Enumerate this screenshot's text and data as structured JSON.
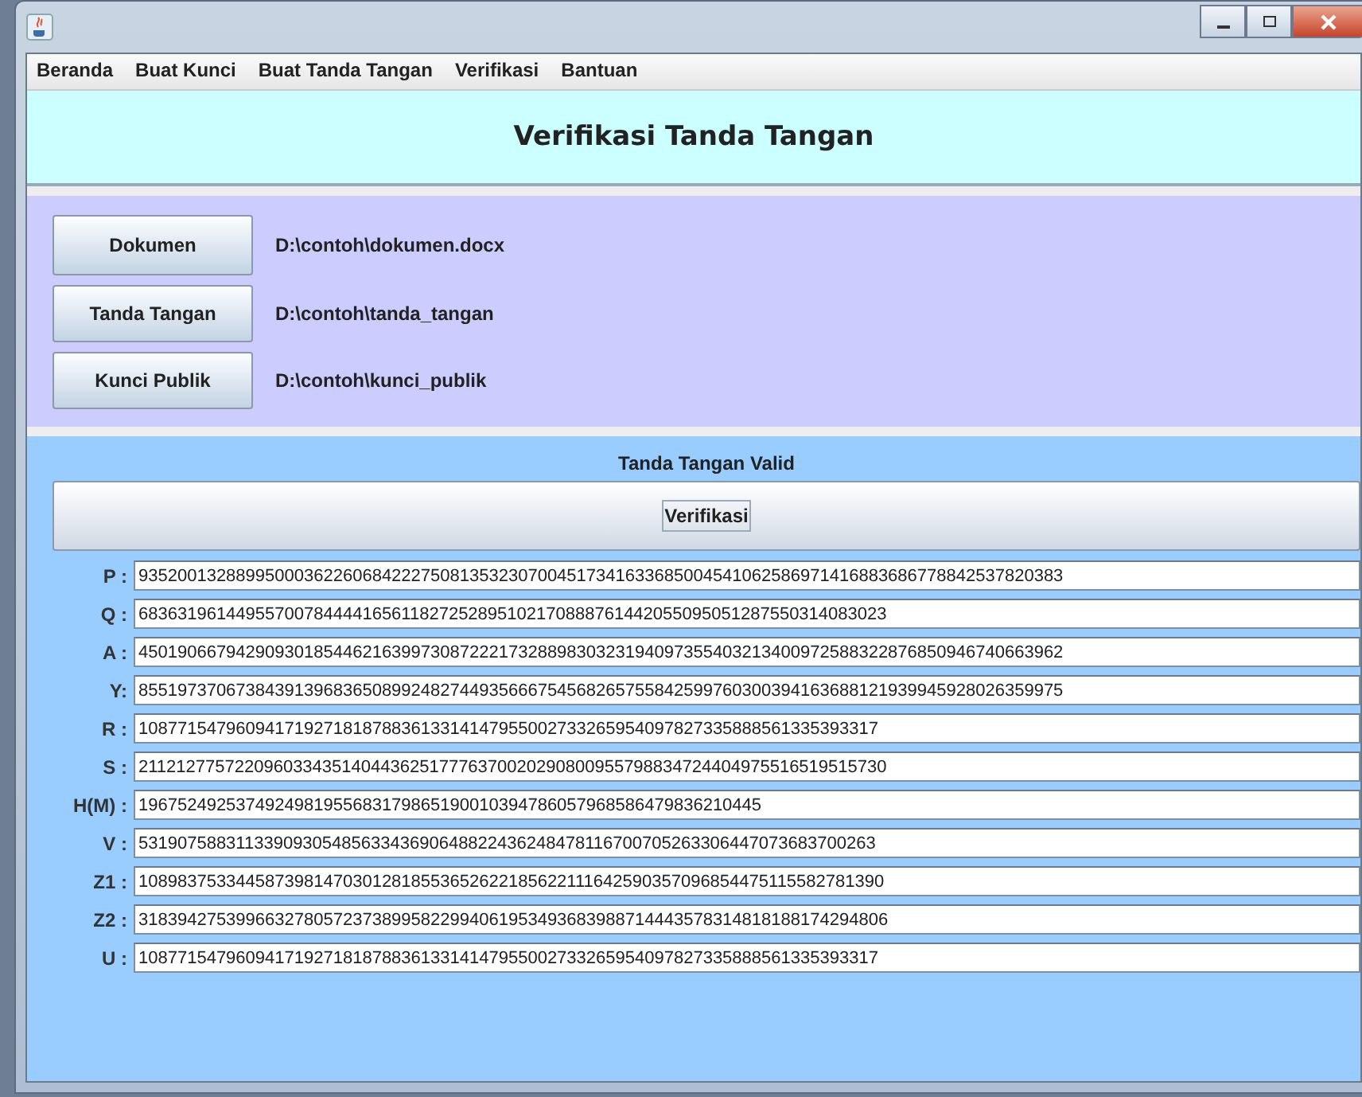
{
  "menu": [
    "Beranda",
    "Buat Kunci",
    "Buat Tanda Tangan",
    "Verifikasi",
    "Bantuan"
  ],
  "header": {
    "title": "Verifikasi Tanda Tangan"
  },
  "files": [
    {
      "button": "Dokumen",
      "path": "D:\\contoh\\dokumen.docx"
    },
    {
      "button": "Tanda Tangan",
      "path": "D:\\contoh\\tanda_tangan"
    },
    {
      "button": "Kunci Publik",
      "path": "D:\\contoh\\kunci_publik"
    }
  ],
  "result": {
    "status": "Tanda Tangan Valid",
    "button": "Verifikasi"
  },
  "fields": [
    {
      "label": "P :",
      "value": "93520013288995000362260684222750813532307004517341633685004541062586971416883686778842537820383"
    },
    {
      "label": "Q :",
      "value": "68363196144955700784444165611827252895102170888761442055095051287550314083023"
    },
    {
      "label": "A :",
      "value": "45019066794290930185446216399730872221732889830323194097355403213400972588322876850946740663962"
    },
    {
      "label": "Y:",
      "value": "85519737067384391396836508992482744935666754568265755842599760300394163688121939945928026359975"
    },
    {
      "label": "R :",
      "value": "1087715479609417192718187883613314147955002733265954097827335888561335393317"
    },
    {
      "label": "S :",
      "value": "21121277572209603343514044362517776370020290800955798834724404975516519515730"
    },
    {
      "label": "H(M) :",
      "value": "1967524925374924981955683179865190010394786057968586479836210445"
    },
    {
      "label": "V :",
      "value": "5319075883113390930548563343690648822436248478116700705263306447073683700263"
    },
    {
      "label": "Z1 :",
      "value": "10898375334458739814703012818553652622185622111642590357096854475115582781390"
    },
    {
      "label": "Z2 :",
      "value": "31839427539966327805723738995822994061953493683988714443578314818188174294806"
    },
    {
      "label": "U :",
      "value": "1087715479609417192718187883613314147955002733265954097827335888561335393317"
    }
  ]
}
